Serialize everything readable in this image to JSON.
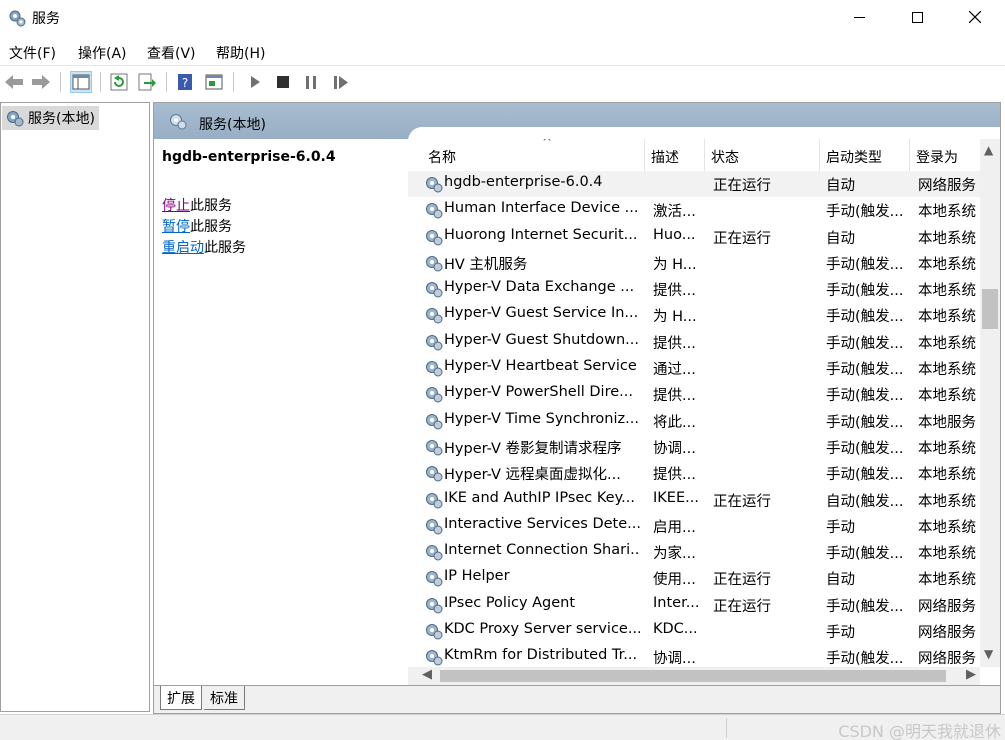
{
  "window": {
    "title": "服务"
  },
  "menu": [
    "文件(F)",
    "操作(A)",
    "查看(V)",
    "帮助(H)"
  ],
  "tree": {
    "root_label": "服务(本地)"
  },
  "pane": {
    "header_title": "服务(本地)",
    "selected_service": "hgdb-enterprise-6.0.4",
    "actions": [
      {
        "link": "停止",
        "suffix": "此服务"
      },
      {
        "link": "暂停",
        "suffix": "此服务"
      },
      {
        "link": "重启动",
        "suffix": "此服务"
      }
    ]
  },
  "columns": [
    "名称",
    "描述",
    "状态",
    "启动类型",
    "登录为"
  ],
  "services": [
    {
      "name": "hgdb-enterprise-6.0.4",
      "desc": "",
      "status": "正在运行",
      "start": "自动",
      "logon": "网络服务"
    },
    {
      "name": "Human Interface Device ...",
      "desc": "激活...",
      "status": "",
      "start": "手动(触发...",
      "logon": "本地系统"
    },
    {
      "name": "Huorong Internet Securit...",
      "desc": "Huo...",
      "status": "正在运行",
      "start": "自动",
      "logon": "本地系统"
    },
    {
      "name": "HV 主机服务",
      "desc": "为 H...",
      "status": "",
      "start": "手动(触发...",
      "logon": "本地系统"
    },
    {
      "name": "Hyper-V Data Exchange ...",
      "desc": "提供...",
      "status": "",
      "start": "手动(触发...",
      "logon": "本地系统"
    },
    {
      "name": "Hyper-V Guest Service In...",
      "desc": "为 H...",
      "status": "",
      "start": "手动(触发...",
      "logon": "本地系统"
    },
    {
      "name": "Hyper-V Guest Shutdown...",
      "desc": "提供...",
      "status": "",
      "start": "手动(触发...",
      "logon": "本地系统"
    },
    {
      "name": "Hyper-V Heartbeat Service",
      "desc": "通过...",
      "status": "",
      "start": "手动(触发...",
      "logon": "本地系统"
    },
    {
      "name": "Hyper-V PowerShell Dire...",
      "desc": "提供...",
      "status": "",
      "start": "手动(触发...",
      "logon": "本地系统"
    },
    {
      "name": "Hyper-V Time Synchroniz...",
      "desc": "将此...",
      "status": "",
      "start": "手动(触发...",
      "logon": "本地服务"
    },
    {
      "name": "Hyper-V 卷影复制请求程序",
      "desc": "协调...",
      "status": "",
      "start": "手动(触发...",
      "logon": "本地系统"
    },
    {
      "name": "Hyper-V 远程桌面虚拟化...",
      "desc": "提供...",
      "status": "",
      "start": "手动(触发...",
      "logon": "本地系统"
    },
    {
      "name": "IKE and AuthIP IPsec Key...",
      "desc": "IKEE...",
      "status": "正在运行",
      "start": "自动(触发...",
      "logon": "本地系统"
    },
    {
      "name": "Interactive Services Dete...",
      "desc": "启用...",
      "status": "",
      "start": "手动",
      "logon": "本地系统"
    },
    {
      "name": "Internet Connection Shari...",
      "desc": "为家...",
      "status": "",
      "start": "手动(触发...",
      "logon": "本地系统"
    },
    {
      "name": "IP Helper",
      "desc": "使用...",
      "status": "正在运行",
      "start": "自动",
      "logon": "本地系统"
    },
    {
      "name": "IPsec Policy Agent",
      "desc": "Inter...",
      "status": "正在运行",
      "start": "手动(触发...",
      "logon": "网络服务"
    },
    {
      "name": "KDC Proxy Server service...",
      "desc": "KDC...",
      "status": "",
      "start": "手动",
      "logon": "网络服务"
    },
    {
      "name": "KtmRm for Distributed Tr...",
      "desc": "协调...",
      "status": "",
      "start": "手动(触发...",
      "logon": "网络服务"
    }
  ],
  "tabs": [
    "扩展",
    "标准"
  ],
  "watermark": "CSDN @明天我就退休"
}
